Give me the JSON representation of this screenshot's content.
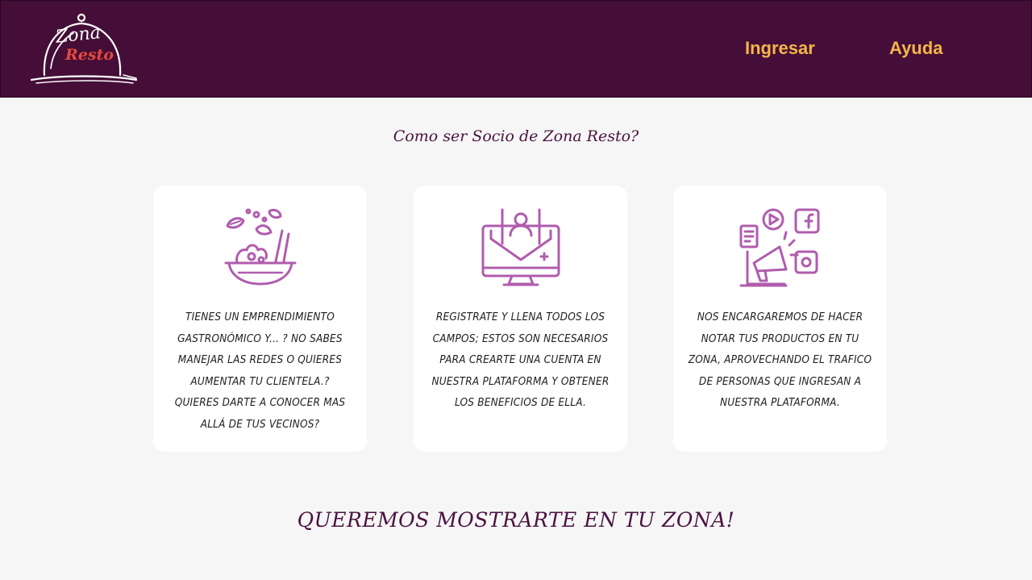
{
  "header": {
    "logo": {
      "word_1": "Zona",
      "word_2": "Resto",
      "icon": "cloche-icon"
    },
    "nav": {
      "ingresar_label": "Ingresar",
      "ayuda_label": "Ayuda"
    }
  },
  "colors": {
    "header_bg": "#440e38",
    "nav_link": "#f5b549",
    "icon_stroke": "#b05cad",
    "heading": "#4a1240",
    "logo_accent": "#e8493c"
  },
  "main": {
    "title": "Como ser Socio de Zona Resto?",
    "cards": [
      {
        "icon": "salad-bowl-icon",
        "text": "Tienes un emprendimiento gastronómico y... ? No sabes manejar las redes o quieres aumentar tu clientela.? Quieres darte a conocer mas allá de tus vecinos?"
      },
      {
        "icon": "computer-signup-icon",
        "text": "Registrate y llena todos los campos; estos son necesarios para crearte una cuenta en nuestra plataforma y obtener los beneficios de ella."
      },
      {
        "icon": "social-media-marketing-icon",
        "text": "Nos encargaremos de hacer notar tus productos en tu Zona, aprovechando el trafico de personas que ingresan a nuestra plataforma."
      }
    ],
    "tagline": "QUEREMOS MOSTRARTE EN TU ZONA!"
  }
}
